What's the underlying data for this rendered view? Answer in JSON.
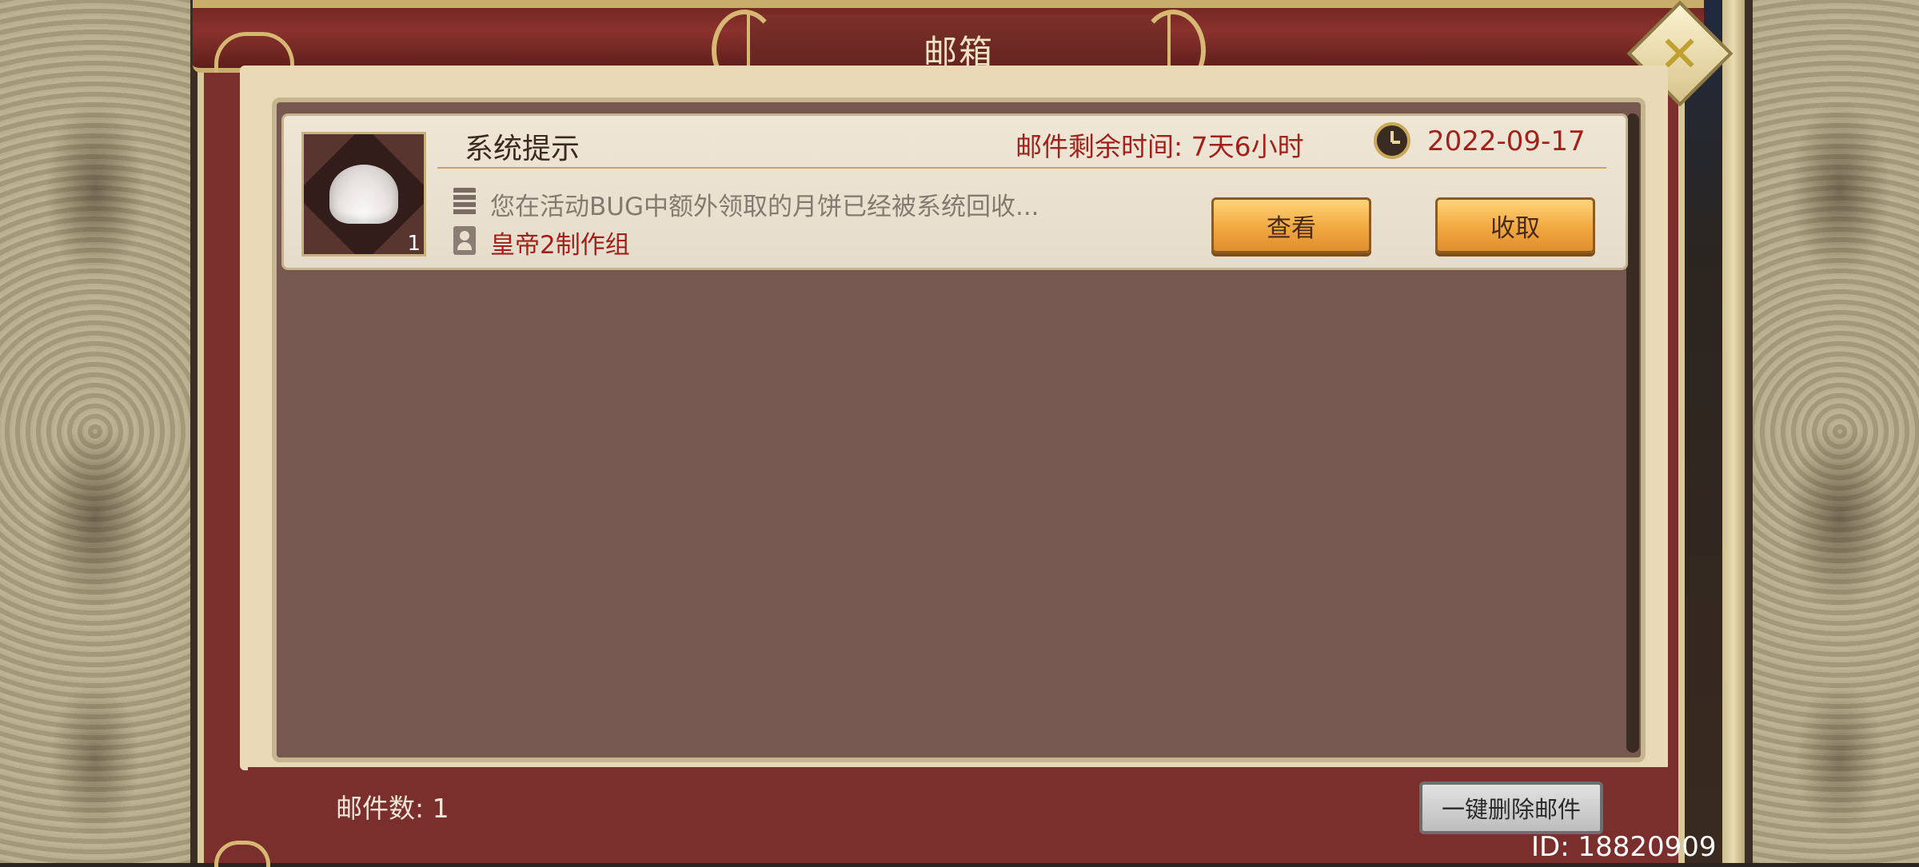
{
  "window": {
    "title": "邮箱"
  },
  "mail": {
    "title": "系统提示",
    "remaining_time": "邮件剩余时间: 7天6小时",
    "date": "2022-09-17",
    "preview": "您在活动BUG中额外领取的月饼已经被系统回收...",
    "sender": "皇帝2制作组",
    "item_count": "1",
    "item_icon": "shell-icon",
    "view_label": "查看",
    "collect_label": "收取"
  },
  "footer": {
    "mail_count": "邮件数: 1",
    "delete_all_label": "一键删除邮件",
    "user_id": "ID: 18820909"
  },
  "colors": {
    "window_red": "#7b2f2c",
    "list_bg": "#775850",
    "accent_gold": "#d7b774",
    "text_red": "#a0221a",
    "button_orange": "#f1a840"
  }
}
